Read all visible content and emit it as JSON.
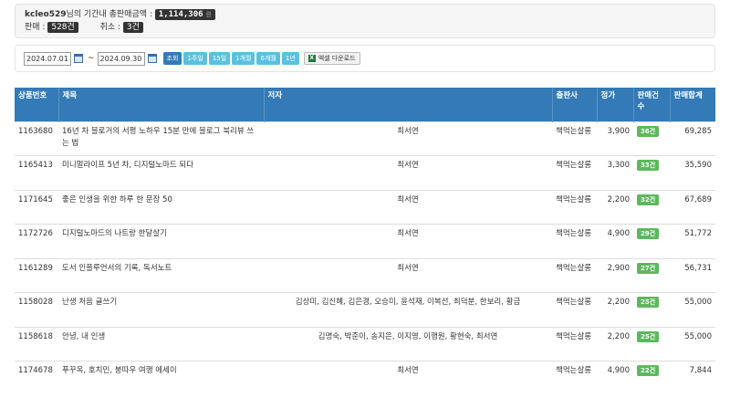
{
  "summary": {
    "user_id": "kcleo529",
    "period_total_label": "님의 기간내 총판매금액 :",
    "total_amount": "1,114,306",
    "total_unit": "원",
    "sales_label": "판매 :",
    "sales_count": "528건",
    "cancel_label": "취소 :",
    "cancel_count": "3건"
  },
  "filter": {
    "start_date": "2024.07.01",
    "end_date": "2024.09.30",
    "tilde": "~",
    "search_button": "조회",
    "ranges": [
      "1주일",
      "15일",
      "1개월",
      "6개월",
      "1년"
    ],
    "excel_button": "엑셀 다운로드",
    "excel_icon_letter": "X"
  },
  "table": {
    "headers": [
      "상품번호",
      "제목",
      "저자",
      "출판사",
      "정가",
      "판매건수",
      "판매합계"
    ],
    "rows": [
      {
        "id": "1163680",
        "title": "16년 차 블로거의 서평 노하우 15분 만에 블로그 북리뷰 쓰는 법",
        "author": "최서연",
        "publisher": "책먹는살롱",
        "price": "3,900",
        "sales": "36건",
        "total": "69,285"
      },
      {
        "id": "1165413",
        "title": "미니멀라이프 5년 차, 디지털노마드 되다",
        "author": "최서연",
        "publisher": "책먹는살롱",
        "price": "3,300",
        "sales": "33건",
        "total": "35,590"
      },
      {
        "id": "1171645",
        "title": "좋은 인생을 위한 하루 한 문장 50",
        "author": "최서연",
        "publisher": "책먹는살롱",
        "price": "2,200",
        "sales": "32건",
        "total": "67,689"
      },
      {
        "id": "1172726",
        "title": "디지털노마드의 나트랑 한달살기",
        "author": "최서연",
        "publisher": "책먹는살롱",
        "price": "4,900",
        "sales": "29건",
        "total": "51,772"
      },
      {
        "id": "1161289",
        "title": "도서 인플루언서의 기록, 독서노트",
        "author": "최서연",
        "publisher": "책먹는살롱",
        "price": "2,900",
        "sales": "27건",
        "total": "56,731"
      },
      {
        "id": "1158028",
        "title": "난생 처음 글쓰기",
        "author": "김상미, 김신혜, 김은경, 오승미, 윤석재, 이복선, 최덕분, 한보리, 황금",
        "publisher": "책먹는살롱",
        "price": "2,200",
        "sales": "25건",
        "total": "55,000"
      },
      {
        "id": "1158618",
        "title": "안녕, 내 인생",
        "author": "김명숙, 박준이, 송지은, 이지영, 이행원, 황현숙, 최서연",
        "publisher": "책먹는살롱",
        "price": "2,200",
        "sales": "25건",
        "total": "55,000"
      },
      {
        "id": "1174678",
        "title": "푸꾸옥, 호치민, 붕따우 여행 에세이",
        "author": "최서연",
        "publisher": "책먹는살롱",
        "price": "4,900",
        "sales": "22건",
        "total": "7,844"
      }
    ]
  },
  "colors": {
    "header_bg": "#337ab7",
    "primary_button": "#337ab7",
    "range_button": "#5bc0de",
    "sales_badge": "#5cb85c",
    "amount_badge": "#333333"
  },
  "icons": {
    "calendar": "calendar-icon",
    "excel": "excel-icon"
  }
}
